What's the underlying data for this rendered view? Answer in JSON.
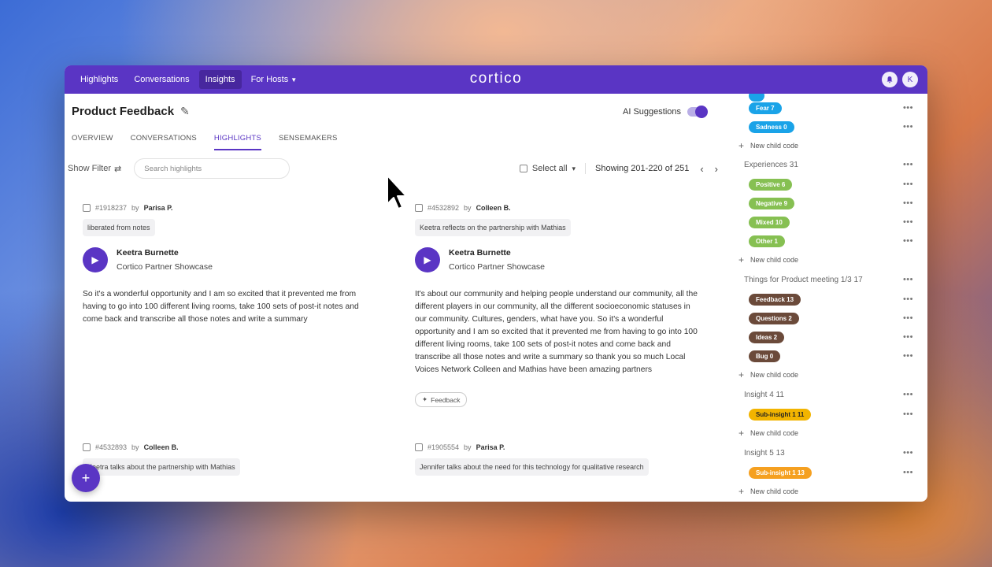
{
  "nav": {
    "items": [
      {
        "label": "Highlights"
      },
      {
        "label": "Conversations"
      },
      {
        "label": "Insights"
      },
      {
        "label": "For Hosts"
      }
    ],
    "logo": "cortico",
    "avatar_initial": "K"
  },
  "page": {
    "title": "Product Feedback",
    "ai_suggestions_label": "AI Suggestions",
    "ai_suggestions_on": true
  },
  "tabs": [
    {
      "label": "OVERVIEW"
    },
    {
      "label": "CONVERSATIONS"
    },
    {
      "label": "HIGHLIGHTS"
    },
    {
      "label": "SENSEMAKERS"
    }
  ],
  "toolbar": {
    "show_filter": "Show Filter",
    "search_placeholder": "Search highlights",
    "select_all": "Select all",
    "pager": "Showing 201-220 of 251"
  },
  "highlights": [
    {
      "id": "#1918237",
      "by": "by",
      "author": "Parisa P.",
      "title": "liberated from notes",
      "speaker": "Keetra Burnette",
      "event": "Cortico Partner Showcase",
      "text": "So it's a wonderful opportunity and I am so excited that it prevented me from having to go into 100 different living rooms, take 100 sets of post-it notes and come back and transcribe all those notes and write a summary"
    },
    {
      "id": "#4532892",
      "by": "by",
      "author": "Colleen B.",
      "title": "Keetra reflects on the partnership with Mathias",
      "speaker": "Keetra Burnette",
      "event": "Cortico Partner Showcase",
      "text": "It's about our community and helping people understand our community, all the different players in our community, all the different socioeconomic statuses in our community. Cultures, genders, what have you. So it's a wonderful opportunity and I am so excited that it prevented me from having to go into 100 different living rooms, take 100 sets of post-it notes and come back and transcribe all those notes and write a summary so thank you so much Local Voices Network Colleen and Mathias have been amazing partners",
      "tag": "Feedback"
    },
    {
      "id": "#4532893",
      "by": "by",
      "author": "Colleen B.",
      "title": "Keetra talks about the partnership with Mathias"
    },
    {
      "id": "#1905554",
      "by": "by",
      "author": "Parisa P.",
      "title": "Jennifer talks about the need for this technology for qualitative research"
    }
  ],
  "sidebar": {
    "emotion_codes": [
      {
        "label": "Fear 7",
        "color": "#1aa3e8"
      },
      {
        "label": "Sadness 0",
        "color": "#1aa3e8"
      }
    ],
    "new_child_label": "New child code",
    "groups": [
      {
        "title": "Experiences 31",
        "codes": [
          {
            "label": "Positive 6",
            "color": "#86c052"
          },
          {
            "label": "Negative 9",
            "color": "#86c052"
          },
          {
            "label": "Mixed 10",
            "color": "#86c052"
          },
          {
            "label": "Other 1",
            "color": "#86c052"
          }
        ]
      },
      {
        "title": "Things for Product meeting 1/3 17",
        "codes": [
          {
            "label": "Feedback 13",
            "color": "#6b4a3a"
          },
          {
            "label": "Questions 2",
            "color": "#6b4a3a"
          },
          {
            "label": "Ideas 2",
            "color": "#6b4a3a"
          },
          {
            "label": "Bug 0",
            "color": "#6b4a3a"
          }
        ]
      },
      {
        "title": "Insight 4 11",
        "codes": [
          {
            "label": "Sub-insight 1 11",
            "color": "#f2b400"
          }
        ]
      },
      {
        "title": "Insight 5 13",
        "codes": [
          {
            "label": "Sub-insight 1 13",
            "color": "#f5a020"
          }
        ]
      }
    ]
  },
  "colors": {
    "brand": "#5a35c4",
    "nav_active": "#47279e"
  }
}
